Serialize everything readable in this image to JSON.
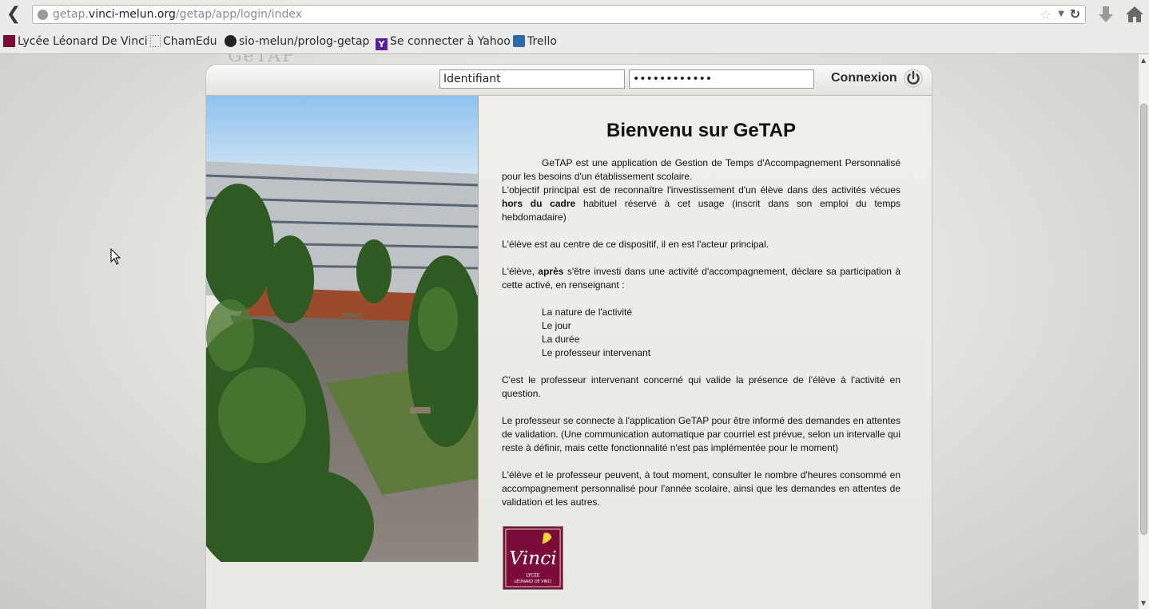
{
  "browser": {
    "url_prefix": "getap.",
    "url_domain": "vinci-melun.org",
    "url_path": "/getap/app/login/index"
  },
  "bookmarks": [
    {
      "label": "Lycée Léonard De Vinci",
      "icon": "vinci-favicon"
    },
    {
      "label": "ChamEdu",
      "icon": "blank-page-icon"
    },
    {
      "label": "sio-melun/prolog-getap",
      "icon": "github-icon"
    },
    {
      "label": "Se connecter à Yahoo",
      "icon": "yahoo-icon"
    },
    {
      "label": "Trello",
      "icon": "trello-icon"
    }
  ],
  "login": {
    "identifiant_value": "Identifiant",
    "password_value": "••••••••••••",
    "connexion_label": "Connexion"
  },
  "content": {
    "title": "Bienvenu sur GeTAP",
    "intro": "GeTAP est une application de Gestion de Temps d'Accompagnement Personnalisé pour les besoins d'un établissement scolaire.",
    "objectif_before": "L'objectif principal est de reconnaître l'investissement d'un élève dans des activités vécues ",
    "objectif_bold": "hors du cadre",
    "objectif_after": " habituel réservé à cet usage (inscrit dans son emploi du temps hebdomadaire)",
    "centre": "L'élève est au centre de ce dispositif, il en est l'acteur principal.",
    "apres_before": "L'élève, ",
    "apres_bold": "après",
    "apres_after": " s'être investi dans une activité d'accompagnement, déclare sa participation à cette activé, en renseignant :",
    "list": [
      "La nature de l'activité",
      "Le jour",
      "La durée",
      "Le professeur intervenant"
    ],
    "validation": "C'est le professeur intervenant concerné qui valide la présence de l'élève à l'activité en question.",
    "professeur": "Le professeur se connecte à l'application GeTAP pour être informé des demandes en attentes de validation.  (Une communication automatique par courriel est prévue, selon un intervalle qui reste à définir, mais cette fonctionnalité n'est pas implémentée pour le moment)",
    "consulter": "L'élève et le professeur peuvent, à tout moment, consulter le nombre d'heures consommé en accompagnement personnalisé pour l'année scolaire, ainsi que les demandes en attentes de validation et les autres."
  },
  "logo": {
    "script": "Vinci",
    "line1": "LYCÉE",
    "line2": "LÉONARD DE VINCI"
  },
  "colors": {
    "logo_bg": "#7b0c3a",
    "page_bg": "#e4e4e0"
  }
}
